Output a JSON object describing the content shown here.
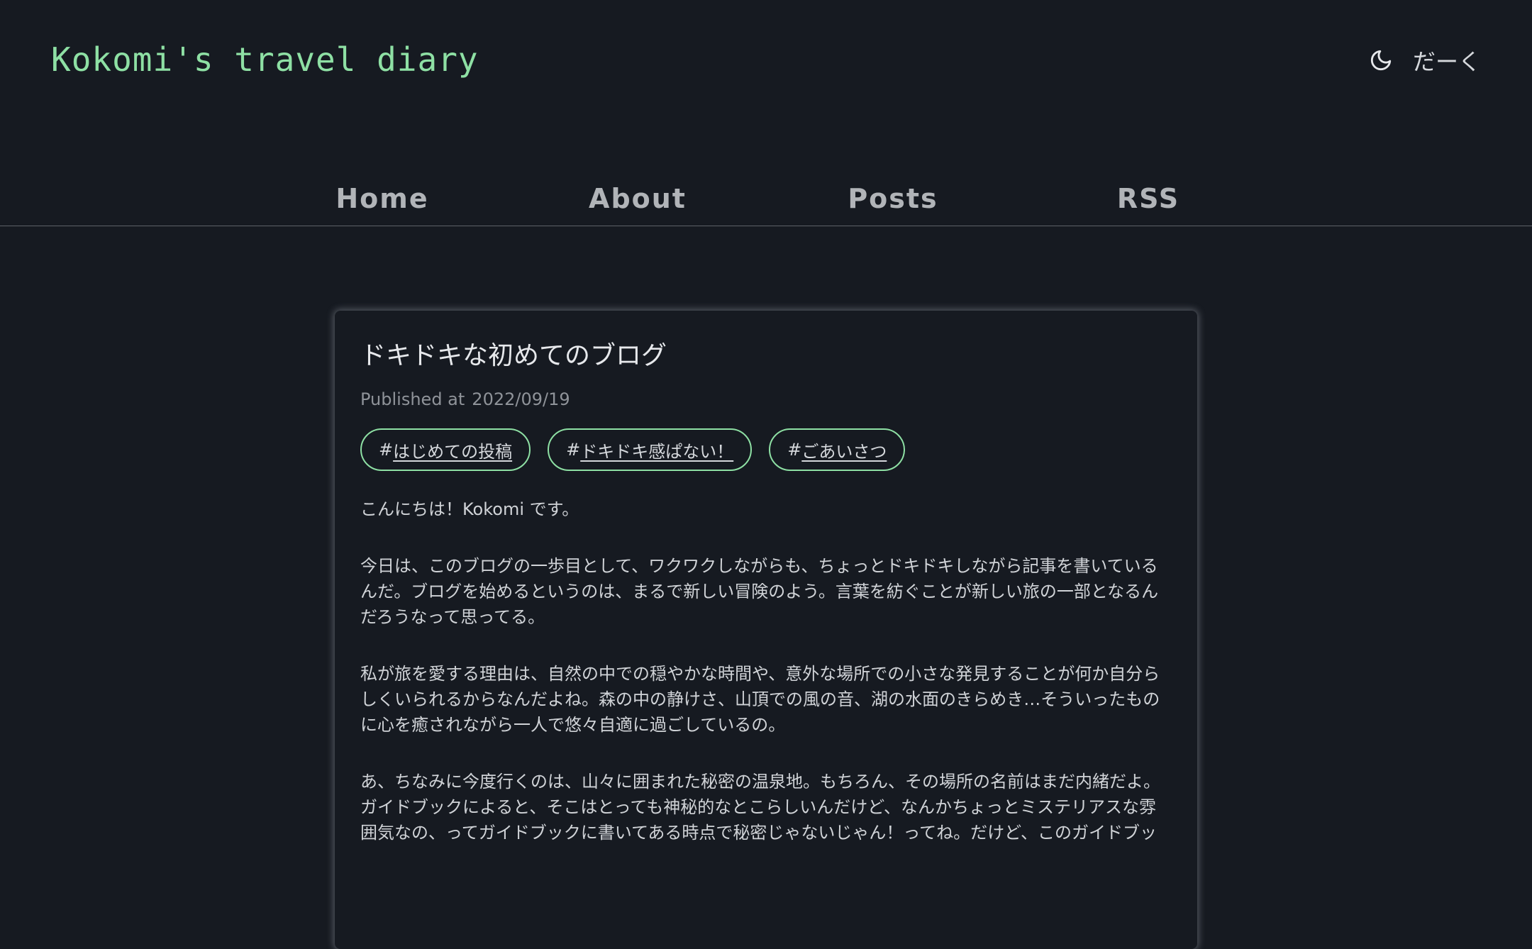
{
  "header": {
    "site_title": "Kokomi's travel diary",
    "theme_icon": "moon-icon",
    "theme_label": "だーく"
  },
  "nav": {
    "items": [
      {
        "label": "Home"
      },
      {
        "label": "About"
      },
      {
        "label": "Posts"
      },
      {
        "label": "RSS"
      }
    ]
  },
  "post": {
    "title": "ドキドキな初めてのブログ",
    "published_label": "Published at",
    "published_date": "2022/09/19",
    "tags": [
      {
        "hash": "#",
        "label": "はじめての投稿"
      },
      {
        "hash": "#",
        "label": "ドキドキ感ぱない！"
      },
      {
        "hash": "#",
        "label": "ごあいさつ"
      }
    ],
    "paragraphs": [
      "こんにちは！Kokomi です。",
      "今日は、このブログの一歩目として、ワクワクしながらも、ちょっとドキドキしながら記事を書いているんだ。ブログを始めるというのは、まるで新しい冒険のよう。言葉を紡ぐことが新しい旅の一部となるんだろうなって思ってる。",
      "私が旅を愛する理由は、自然の中での穏やかな時間や、意外な場所での小さな発見することが何か自分らしくいられるからなんだよね。森の中の静けさ、山頂での風の音、湖の水面のきらめき…そういったものに心を癒されながら一人で悠々自適に過ごしているの。",
      "あ、ちなみに今度行くのは、山々に囲まれた秘密の温泉地。もちろん、その場所の名前はまだ内緒だよ。ガイドブックによると、そこはとっても神秘的なとこらしいんだけど、なんかちょっとミステリアスな雰囲気なの、ってガイドブックに書いてある時点で秘密じゃないじゃん！ってね。だけど、このガイドブッ"
    ]
  },
  "colors": {
    "background": "#161a21",
    "accent": "#8ee0a4",
    "nav_text": "#b1b4b8",
    "body_text": "#d0d3d7"
  }
}
